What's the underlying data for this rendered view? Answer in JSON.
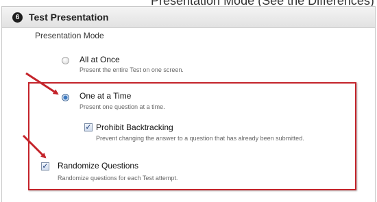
{
  "page_header": {
    "partial_text": "Presentation Mode (See the Differences)"
  },
  "panel": {
    "step_number": "6",
    "title": "Test Presentation"
  },
  "presentation_mode": {
    "label": "Presentation Mode",
    "options": [
      {
        "label": "All at Once",
        "description": "Present the entire Test on one screen.",
        "selected": false
      },
      {
        "label": "One at a Time",
        "description": "Present one question at a time.",
        "selected": true
      }
    ],
    "prohibit_backtracking": {
      "label": "Prohibit Backtracking",
      "description": "Prevent changing the answer to a question that has already been submitted.",
      "checked": true
    }
  },
  "randomize_questions": {
    "label": "Randomize Questions",
    "description": "Randomize questions for each Test attempt.",
    "checked": true
  },
  "annotation": {
    "highlight_color": "#c4232a",
    "check_glyph": "✓"
  }
}
